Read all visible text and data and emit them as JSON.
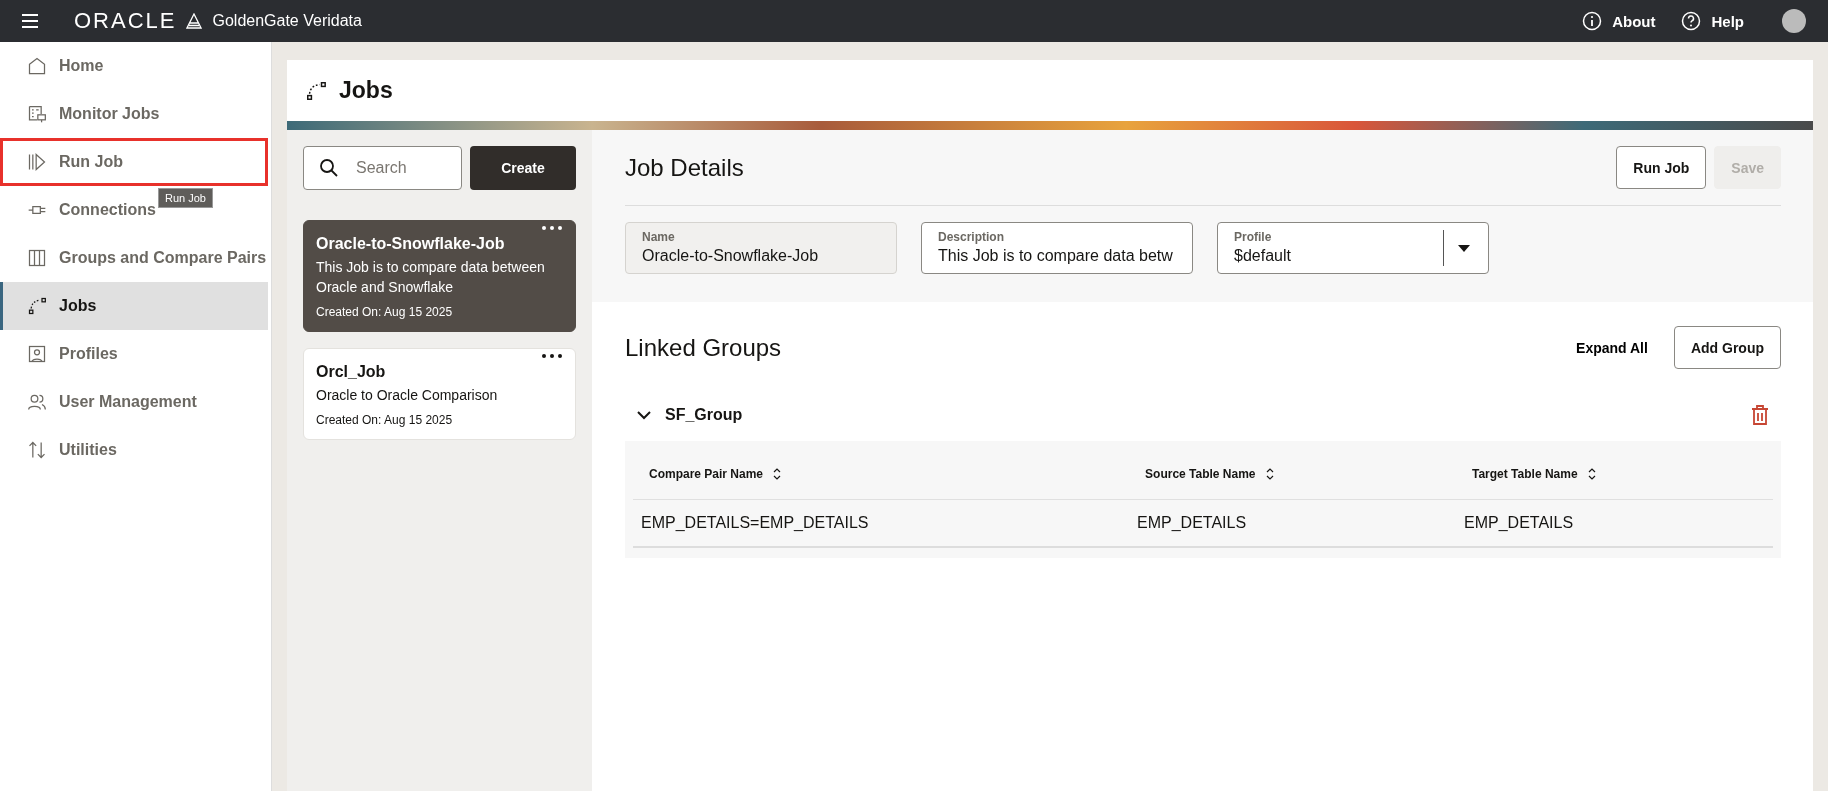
{
  "topbar": {
    "brand": "ORACLE",
    "product": "GoldenGate Veridata",
    "links": [
      {
        "kind": "about",
        "label": "About"
      },
      {
        "kind": "help",
        "label": "Help"
      }
    ]
  },
  "sidebar": {
    "items": [
      {
        "label": "Home",
        "selected": false,
        "outlined": false
      },
      {
        "label": "Monitor Jobs",
        "selected": false,
        "outlined": false
      },
      {
        "label": "Run Job",
        "selected": false,
        "outlined": true
      },
      {
        "label": "Connections",
        "selected": false,
        "outlined": false
      },
      {
        "label": "Groups and Compare Pairs",
        "selected": false,
        "outlined": false
      },
      {
        "label": "Jobs",
        "selected": true,
        "outlined": false
      },
      {
        "label": "Profiles",
        "selected": false,
        "outlined": false
      },
      {
        "label": "User Management",
        "selected": false,
        "outlined": false
      },
      {
        "label": "Utilities",
        "selected": false,
        "outlined": false
      }
    ],
    "tooltip": "Run Job"
  },
  "page": {
    "title": "Jobs"
  },
  "job_list": {
    "search": {
      "placeholder": "Search"
    },
    "create_button": "Create",
    "jobs": [
      {
        "name": "Oracle-to-Snowflake-Job",
        "description": "This Job is to compare data between Oracle and Snowflake",
        "created": "Created On: Aug 15 2025",
        "selected": true
      },
      {
        "name": "Orcl_Job",
        "description": "Oracle to Oracle Comparison",
        "created": "Created On: Aug 15 2025",
        "selected": false
      }
    ]
  },
  "job_details": {
    "title": "Job Details",
    "buttons": [
      {
        "label": "Run Job",
        "disabled": false
      },
      {
        "label": "Save",
        "disabled": true
      }
    ],
    "fields": [
      {
        "kind": "text",
        "label": "Name",
        "value": "Oracle-to-Snowflake-Job",
        "readonly": true
      },
      {
        "kind": "text",
        "label": "Description",
        "value": "This Job is to compare data betw",
        "readonly": false
      },
      {
        "kind": "select",
        "label": "Profile",
        "value": "$default",
        "readonly": false
      }
    ]
  },
  "linked_groups": {
    "title": "Linked Groups",
    "expand_all": "Expand All",
    "add_button": "Add Group",
    "groups": [
      {
        "name": "SF_Group",
        "expanded": true,
        "table": {
          "columns": [
            "Compare Pair Name",
            "Source Table Name",
            "Target Table Name"
          ],
          "rows": [
            [
              "EMP_DETAILS=EMP_DETAILS",
              "EMP_DETAILS",
              "EMP_DETAILS"
            ]
          ]
        }
      }
    ]
  }
}
